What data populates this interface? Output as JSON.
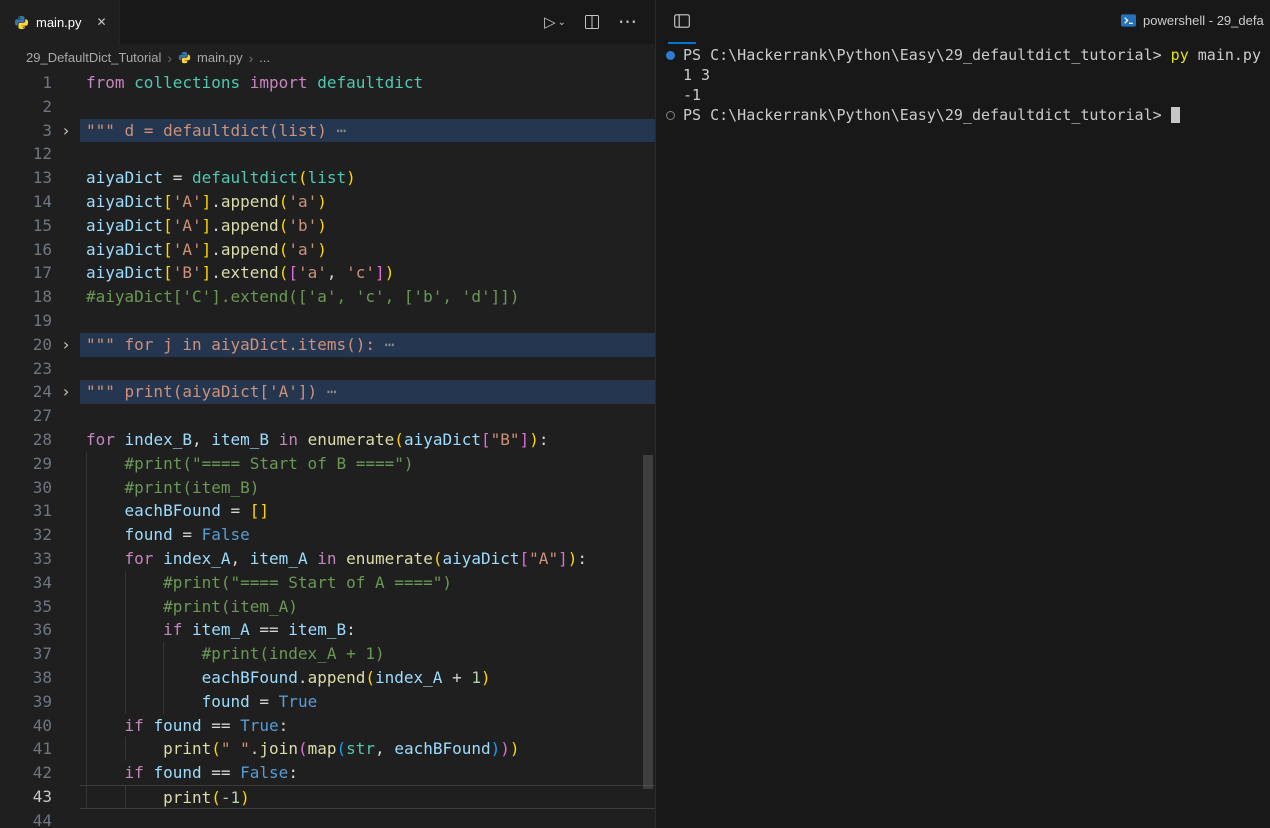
{
  "colors": {
    "accent": "#0078d4",
    "editor_bg": "#1f1f1f",
    "panel_bg": "#181818",
    "fold_highlight": "#253650",
    "token_keyword": "#C586C0",
    "token_variable": "#9CDCFE",
    "token_function": "#DCDCAA",
    "token_string": "#CE9178",
    "token_comment": "#6A9955",
    "token_number": "#B5CEA8",
    "token_constant": "#569CD6",
    "token_class": "#4EC9B0",
    "bracket_level_1": "#FFD700",
    "bracket_level_2": "#DA70D6",
    "bracket_level_3": "#179FFF",
    "terminal_command": "#e5e510",
    "command_decoration_blue": "#2e7cd6"
  },
  "icons": {
    "close": "✕",
    "run": "▷",
    "dropdown": "⌄",
    "more": "⋯",
    "breadcrumb_sep": "›",
    "fold_chevron": "›"
  },
  "editor": {
    "tab_label": "main.py",
    "breadcrumb": {
      "folder": "29_DefaultDict_Tutorial",
      "file": "main.py",
      "symbol": "..."
    },
    "lines": [
      {
        "n": 1,
        "tokens": [
          [
            "k",
            "from"
          ],
          [
            "p",
            " "
          ],
          [
            "t",
            "collections"
          ],
          [
            "p",
            " "
          ],
          [
            "k",
            "import"
          ],
          [
            "p",
            " "
          ],
          [
            "t",
            "defaultdict"
          ]
        ]
      },
      {
        "n": 2,
        "tokens": []
      },
      {
        "n": 3,
        "fold": true,
        "hl": true,
        "tokens": [
          [
            "s",
            "\"\"\" d = defaultdict(list)"
          ],
          [
            "e",
            " ⋯"
          ]
        ]
      },
      {
        "n": 12,
        "tokens": []
      },
      {
        "n": 13,
        "tokens": [
          [
            "v",
            "aiyaDict"
          ],
          [
            "p",
            " = "
          ],
          [
            "t",
            "defaultdict"
          ],
          [
            "b1",
            "("
          ],
          [
            "t",
            "list"
          ],
          [
            "b1",
            ")"
          ]
        ]
      },
      {
        "n": 14,
        "tokens": [
          [
            "v",
            "aiyaDict"
          ],
          [
            "b1",
            "["
          ],
          [
            "s",
            "'A'"
          ],
          [
            "b1",
            "]"
          ],
          [
            "p",
            "."
          ],
          [
            "f",
            "append"
          ],
          [
            "b1",
            "("
          ],
          [
            "s",
            "'a'"
          ],
          [
            "b1",
            ")"
          ]
        ]
      },
      {
        "n": 15,
        "tokens": [
          [
            "v",
            "aiyaDict"
          ],
          [
            "b1",
            "["
          ],
          [
            "s",
            "'A'"
          ],
          [
            "b1",
            "]"
          ],
          [
            "p",
            "."
          ],
          [
            "f",
            "append"
          ],
          [
            "b1",
            "("
          ],
          [
            "s",
            "'b'"
          ],
          [
            "b1",
            ")"
          ]
        ]
      },
      {
        "n": 16,
        "tokens": [
          [
            "v",
            "aiyaDict"
          ],
          [
            "b1",
            "["
          ],
          [
            "s",
            "'A'"
          ],
          [
            "b1",
            "]"
          ],
          [
            "p",
            "."
          ],
          [
            "f",
            "append"
          ],
          [
            "b1",
            "("
          ],
          [
            "s",
            "'a'"
          ],
          [
            "b1",
            ")"
          ]
        ]
      },
      {
        "n": 17,
        "tokens": [
          [
            "v",
            "aiyaDict"
          ],
          [
            "b1",
            "["
          ],
          [
            "s",
            "'B'"
          ],
          [
            "b1",
            "]"
          ],
          [
            "p",
            "."
          ],
          [
            "f",
            "extend"
          ],
          [
            "b1",
            "("
          ],
          [
            "b2",
            "["
          ],
          [
            "s",
            "'a'"
          ],
          [
            "p",
            ", "
          ],
          [
            "s",
            "'c'"
          ],
          [
            "b2",
            "]"
          ],
          [
            "b1",
            ")"
          ]
        ]
      },
      {
        "n": 18,
        "tokens": [
          [
            "c",
            "#aiyaDict['C'].extend(['a', 'c', ['b', 'd']])"
          ]
        ]
      },
      {
        "n": 19,
        "tokens": []
      },
      {
        "n": 20,
        "fold": true,
        "hl": true,
        "tokens": [
          [
            "s",
            "\"\"\" for j in aiyaDict.items():"
          ],
          [
            "e",
            " ⋯"
          ]
        ]
      },
      {
        "n": 23,
        "tokens": []
      },
      {
        "n": 24,
        "fold": true,
        "hl": true,
        "tokens": [
          [
            "s",
            "\"\"\" print(aiyaDict['A'])"
          ],
          [
            "e",
            " ⋯"
          ]
        ]
      },
      {
        "n": 27,
        "tokens": []
      },
      {
        "n": 28,
        "tokens": [
          [
            "k",
            "for"
          ],
          [
            "p",
            " "
          ],
          [
            "v",
            "index_B"
          ],
          [
            "p",
            ", "
          ],
          [
            "v",
            "item_B"
          ],
          [
            "p",
            " "
          ],
          [
            "k",
            "in"
          ],
          [
            "p",
            " "
          ],
          [
            "f",
            "enumerate"
          ],
          [
            "b1",
            "("
          ],
          [
            "v",
            "aiyaDict"
          ],
          [
            "b2",
            "["
          ],
          [
            "s",
            "\"B\""
          ],
          [
            "b2",
            "]"
          ],
          [
            "b1",
            ")"
          ],
          [
            "p",
            ":"
          ]
        ]
      },
      {
        "n": 29,
        "ind": 1,
        "tokens": [
          [
            "c",
            "#print(\"==== Start of B ====\")"
          ]
        ]
      },
      {
        "n": 30,
        "ind": 1,
        "tokens": [
          [
            "c",
            "#print(item_B)"
          ]
        ]
      },
      {
        "n": 31,
        "ind": 1,
        "tokens": [
          [
            "v",
            "eachBFound"
          ],
          [
            "p",
            " = "
          ],
          [
            "b1",
            "[]"
          ]
        ]
      },
      {
        "n": 32,
        "ind": 1,
        "tokens": [
          [
            "v",
            "found"
          ],
          [
            "p",
            " = "
          ],
          [
            "b",
            "False"
          ]
        ]
      },
      {
        "n": 33,
        "ind": 1,
        "tokens": [
          [
            "k",
            "for"
          ],
          [
            "p",
            " "
          ],
          [
            "v",
            "index_A"
          ],
          [
            "p",
            ", "
          ],
          [
            "v",
            "item_A"
          ],
          [
            "p",
            " "
          ],
          [
            "k",
            "in"
          ],
          [
            "p",
            " "
          ],
          [
            "f",
            "enumerate"
          ],
          [
            "b1",
            "("
          ],
          [
            "v",
            "aiyaDict"
          ],
          [
            "b2",
            "["
          ],
          [
            "s",
            "\"A\""
          ],
          [
            "b2",
            "]"
          ],
          [
            "b1",
            ")"
          ],
          [
            "p",
            ":"
          ]
        ]
      },
      {
        "n": 34,
        "ind": 2,
        "tokens": [
          [
            "c",
            "#print(\"==== Start of A ====\")"
          ]
        ]
      },
      {
        "n": 35,
        "ind": 2,
        "tokens": [
          [
            "c",
            "#print(item_A)"
          ]
        ]
      },
      {
        "n": 36,
        "ind": 2,
        "tokens": [
          [
            "k",
            "if"
          ],
          [
            "p",
            " "
          ],
          [
            "v",
            "item_A"
          ],
          [
            "p",
            " == "
          ],
          [
            "v",
            "item_B"
          ],
          [
            "p",
            ":"
          ]
        ]
      },
      {
        "n": 37,
        "ind": 3,
        "tokens": [
          [
            "c",
            "#print(index_A + 1)"
          ]
        ]
      },
      {
        "n": 38,
        "ind": 3,
        "tokens": [
          [
            "v",
            "eachBFound"
          ],
          [
            "p",
            "."
          ],
          [
            "f",
            "append"
          ],
          [
            "b1",
            "("
          ],
          [
            "v",
            "index_A"
          ],
          [
            "p",
            " + "
          ],
          [
            "n",
            "1"
          ],
          [
            "b1",
            ")"
          ]
        ]
      },
      {
        "n": 39,
        "ind": 3,
        "tokens": [
          [
            "v",
            "found"
          ],
          [
            "p",
            " = "
          ],
          [
            "b",
            "True"
          ]
        ]
      },
      {
        "n": 40,
        "ind": 1,
        "tokens": [
          [
            "k",
            "if"
          ],
          [
            "p",
            " "
          ],
          [
            "v",
            "found"
          ],
          [
            "p",
            " == "
          ],
          [
            "b",
            "True"
          ],
          [
            "p",
            ":"
          ]
        ]
      },
      {
        "n": 41,
        "ind": 2,
        "tokens": [
          [
            "f",
            "print"
          ],
          [
            "b1",
            "("
          ],
          [
            "s",
            "\" \""
          ],
          [
            "p",
            "."
          ],
          [
            "f",
            "join"
          ],
          [
            "b2",
            "("
          ],
          [
            "f",
            "map"
          ],
          [
            "b3",
            "("
          ],
          [
            "t",
            "str"
          ],
          [
            "p",
            ", "
          ],
          [
            "v",
            "eachBFound"
          ],
          [
            "b3",
            ")"
          ],
          [
            "b2",
            ")"
          ],
          [
            "b1",
            ")"
          ]
        ]
      },
      {
        "n": 42,
        "ind": 1,
        "tokens": [
          [
            "k",
            "if"
          ],
          [
            "p",
            " "
          ],
          [
            "v",
            "found"
          ],
          [
            "p",
            " == "
          ],
          [
            "b",
            "False"
          ],
          [
            "p",
            ":"
          ]
        ]
      },
      {
        "n": 43,
        "ind": 2,
        "cur": true,
        "tokens": [
          [
            "f",
            "print"
          ],
          [
            "b1",
            "("
          ],
          [
            "n",
            "-1"
          ],
          [
            "b1",
            ")"
          ]
        ]
      },
      {
        "n": 44,
        "tokens": []
      }
    ]
  },
  "terminal": {
    "title": "powershell - 29_defa",
    "lines": [
      {
        "deco": "filled",
        "spans": [
          [
            "prompt",
            "PS C:\\Hackerrank\\Python\\Easy\\29_defaultdict_tutorial> "
          ],
          [
            "cmd",
            "py"
          ],
          [
            "plain",
            " main.py"
          ]
        ]
      },
      {
        "spans": [
          [
            "out",
            "1 3"
          ]
        ]
      },
      {
        "spans": [
          [
            "out",
            "-1"
          ]
        ]
      },
      {
        "deco": "hollow",
        "cursor": true,
        "spans": [
          [
            "prompt",
            "PS C:\\Hackerrank\\Python\\Easy\\29_defaultdict_tutorial> "
          ]
        ]
      }
    ]
  }
}
